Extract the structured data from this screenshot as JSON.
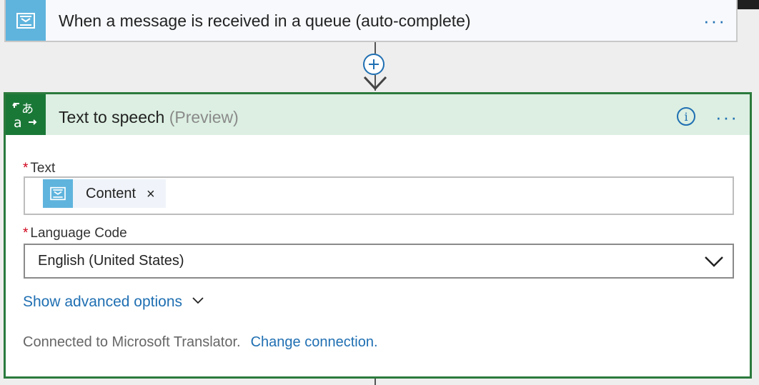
{
  "trigger": {
    "title": "When a message is received in a queue (auto-complete)",
    "icon": "service-bus-queue-icon",
    "more_label": "···"
  },
  "add_step": {
    "icon": "plus-icon"
  },
  "action": {
    "title": "Text to speech",
    "title_suffix": "(Preview)",
    "icon": "translator-icon",
    "info_label": "i",
    "more_label": "···",
    "fields": {
      "text": {
        "label": "Text",
        "required_marker": "*",
        "token": {
          "label": "Content",
          "remove_label": "×",
          "icon": "service-bus-queue-icon"
        }
      },
      "language_code": {
        "label": "Language Code",
        "required_marker": "*",
        "value": "English (United States)",
        "icon": "chevron-down-icon"
      }
    },
    "advanced_options_label": "Show advanced options",
    "connection": {
      "text": "Connected to Microsoft Translator.",
      "change_label": "Change connection."
    }
  },
  "colors": {
    "accent": "#1f6fb2",
    "trigger_icon_bg": "#5fb4dd",
    "action_border": "#2b7a3d",
    "action_header_bg": "#dcefe2",
    "action_icon_bg": "#1a7837",
    "required": "#d0021b"
  }
}
